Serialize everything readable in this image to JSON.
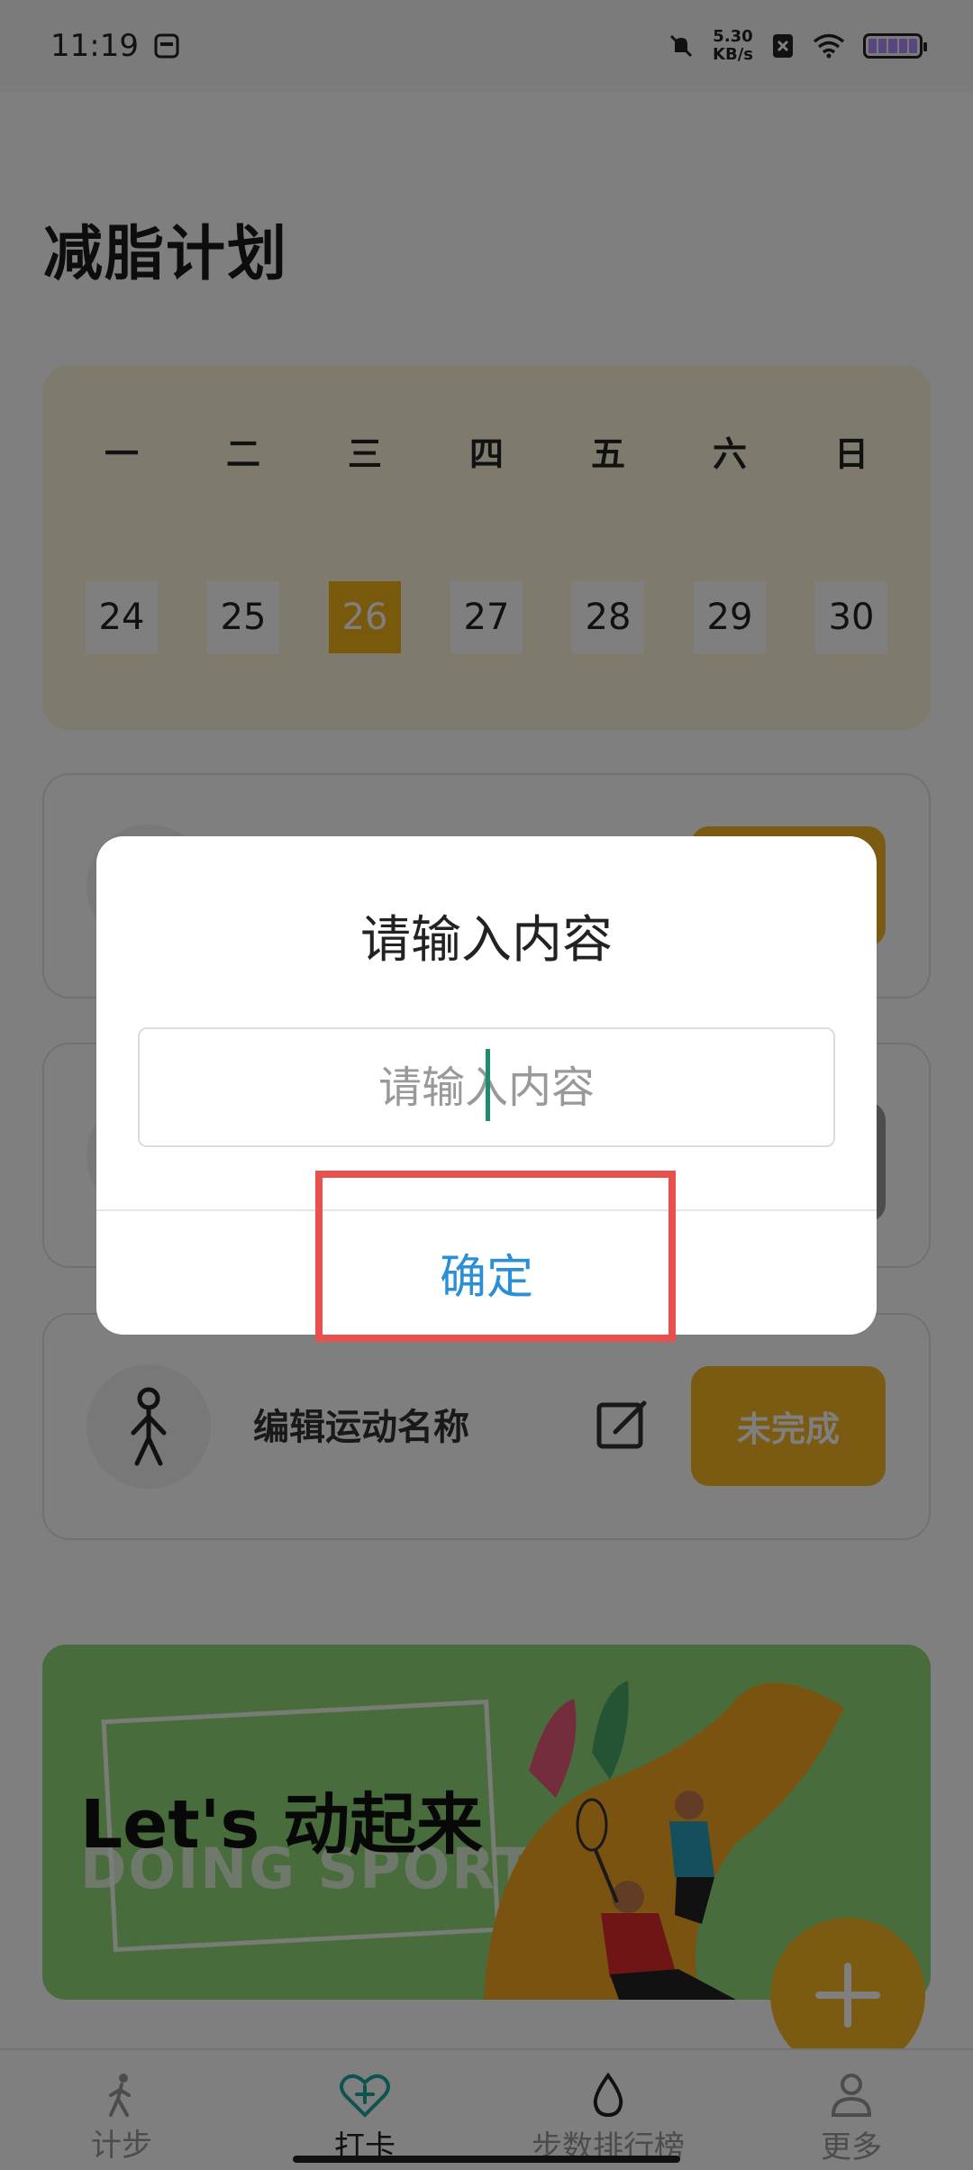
{
  "status_bar": {
    "time": "11:19",
    "speed_value": "5.30",
    "speed_unit": "KB/s"
  },
  "page": {
    "title": "减脂计划"
  },
  "calendar": {
    "weekdays": [
      "一",
      "二",
      "三",
      "四",
      "五",
      "六",
      "日"
    ],
    "dates": [
      "24",
      "25",
      "26",
      "27",
      "28",
      "29",
      "30"
    ],
    "selected": "26"
  },
  "cards": [
    {
      "name": "",
      "status": ""
    },
    {
      "name": "",
      "status": ""
    },
    {
      "name": "编辑运动名称",
      "status": "未完成"
    }
  ],
  "banner": {
    "title": "Let's 动起来",
    "subtitle": "DOING SPORT"
  },
  "tabs": [
    {
      "label": "计步",
      "icon": "walk-icon"
    },
    {
      "label": "打卡",
      "icon": "heart-plus-icon",
      "active": true
    },
    {
      "label": "步数排行榜",
      "icon": "drop-icon"
    },
    {
      "label": "更多",
      "icon": "person-icon"
    }
  ],
  "dialog": {
    "title": "请输入内容",
    "input_placeholder": "请输入内容",
    "input_value": "",
    "confirm_label": "确定"
  },
  "colors": {
    "accent": "#f5b623",
    "confirm_text": "#2b8fd6",
    "highlight": "#e8504e",
    "banner_bg": "#93d87a"
  }
}
